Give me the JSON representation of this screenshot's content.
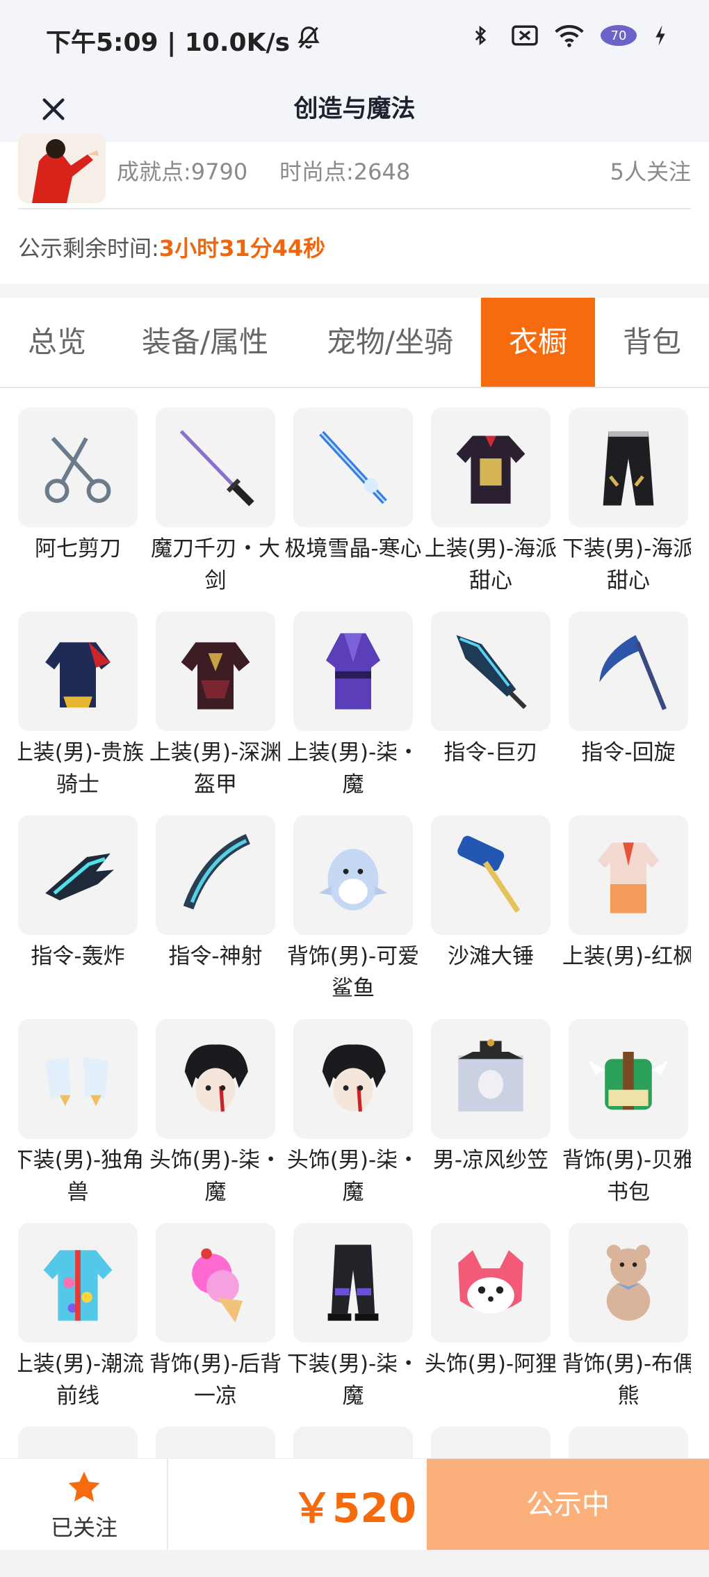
{
  "status_bar": {
    "time_speed": "下午5:09 | 10.0K/s",
    "battery": "70",
    "icons": [
      "mute-bell-icon",
      "bluetooth-icon",
      "no-sim-icon",
      "wifi-icon",
      "battery-icon",
      "charging-icon"
    ]
  },
  "nav": {
    "title": "创造与魔法",
    "close_icon": "close-icon"
  },
  "profile": {
    "achievement": "成就点:9790",
    "fashion": "时尚点:2648",
    "followers": "5人关注"
  },
  "countdown": {
    "label": "公示剩余时间:",
    "time": "3小时31分44秒"
  },
  "tabs": [
    {
      "label": "总览",
      "active": false
    },
    {
      "label": "装备/属性",
      "active": false
    },
    {
      "label": "宠物/坐骑",
      "active": false
    },
    {
      "label": "衣橱",
      "active": true
    },
    {
      "label": "背包",
      "active": false
    }
  ],
  "items": [
    {
      "name": "阿七剪刀",
      "icon": "scissors-icon"
    },
    {
      "name": "魔刀千刃・大剑",
      "icon": "katana-icon"
    },
    {
      "name": "极境雪晶-寒心",
      "icon": "ice-sword-icon"
    },
    {
      "name": "上装(男)-海派甜心",
      "icon": "jacket-icon"
    },
    {
      "name": "下装(男)-海派甜心",
      "icon": "pants-icon"
    },
    {
      "name": "上装(男)-贵族骑士",
      "icon": "knight-top-icon"
    },
    {
      "name": "上装(男)-深渊盔甲",
      "icon": "armor-icon"
    },
    {
      "name": "上装(男)-柒・魔",
      "icon": "robe-icon"
    },
    {
      "name": "指令-巨刃",
      "icon": "great-blade-icon"
    },
    {
      "name": "指令-回旋",
      "icon": "scythe-icon"
    },
    {
      "name": "指令-轰炸",
      "icon": "bomb-claw-icon"
    },
    {
      "name": "指令-神射",
      "icon": "bow-icon"
    },
    {
      "name": "背饰(男)-可爱鲨鱼",
      "icon": "shark-icon"
    },
    {
      "name": "沙滩大锤",
      "icon": "hammer-icon"
    },
    {
      "name": "上装(男)-红枫",
      "icon": "maple-top-icon"
    },
    {
      "name": "下装(男)-独角兽",
      "icon": "unicorn-boots-icon"
    },
    {
      "name": "头饰(男)-柒・魔",
      "icon": "hair-icon"
    },
    {
      "name": "头饰(男)-柒・魔",
      "icon": "hair-icon"
    },
    {
      "name": "男-凉风纱笠",
      "icon": "veil-hat-icon"
    },
    {
      "name": "背饰(男)-贝雅书包",
      "icon": "backpack-icon"
    },
    {
      "name": "上装(男)-潮流前线",
      "icon": "hoodie-icon"
    },
    {
      "name": "背饰(男)-后背一凉",
      "icon": "ice-cream-icon"
    },
    {
      "name": "下装(男)-柒・魔",
      "icon": "dark-pants-icon"
    },
    {
      "name": "头饰(男)-阿狸",
      "icon": "fox-head-icon"
    },
    {
      "name": "背饰(男)-布偶熊",
      "icon": "teddy-bear-icon"
    },
    {
      "name": "",
      "icon": "item-icon"
    },
    {
      "name": "",
      "icon": "item-icon"
    },
    {
      "name": "",
      "icon": "item-icon"
    },
    {
      "name": "",
      "icon": "item-icon"
    },
    {
      "name": "",
      "icon": "item-icon"
    }
  ],
  "bottom": {
    "follow_label": "已关注",
    "price": "￥520",
    "action_label": "公示中"
  },
  "colors": {
    "accent": "#f76b0f",
    "price": "#f46a0d",
    "action_bg": "#fbb07b",
    "header_bg": "#f3f5f8"
  }
}
